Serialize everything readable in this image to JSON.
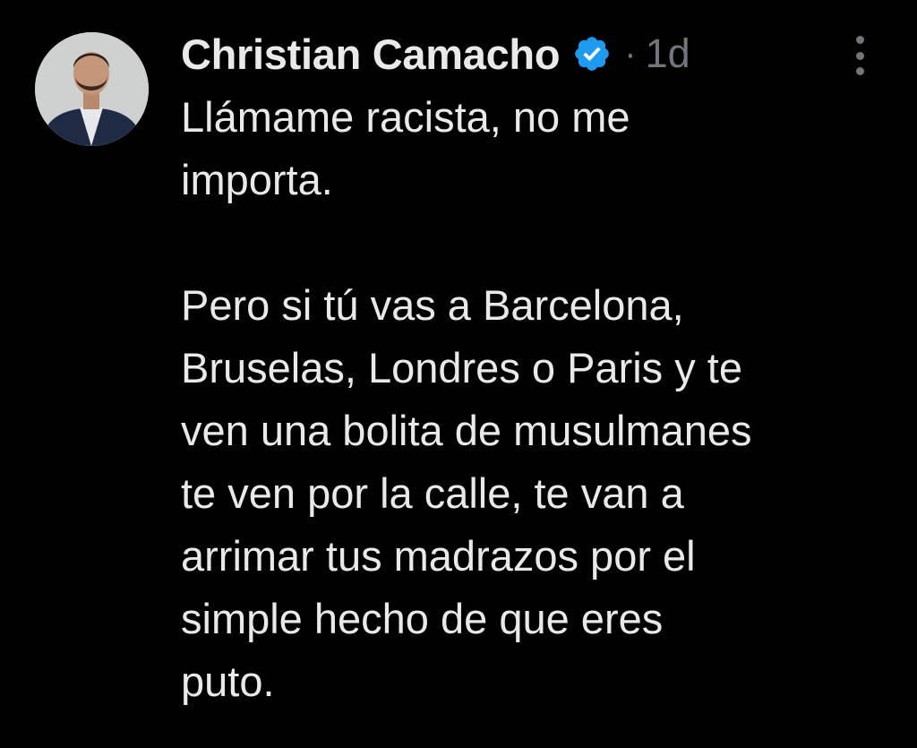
{
  "tweet": {
    "author_name": "Christian Camacho",
    "verified": true,
    "separator": "·",
    "time_ago": "1d",
    "paragraphs": [
      "Llámame racista, no me\nimporta.",
      "Pero si tú vas a Barcelona,\nBruselas, Londres o Paris y te\nven una bolita de musulmanes\nte ven por la calle, te van a\narrimar tus madrazos por el\nsimple hecho de que eres\nputo."
    ]
  },
  "icons": {
    "verified": "verified-badge-icon",
    "more": "more-options-icon"
  },
  "colors": {
    "background": "#000000",
    "text": "#e7e9ea",
    "muted": "#71767b",
    "verified_blue": "#1d9bf0"
  }
}
